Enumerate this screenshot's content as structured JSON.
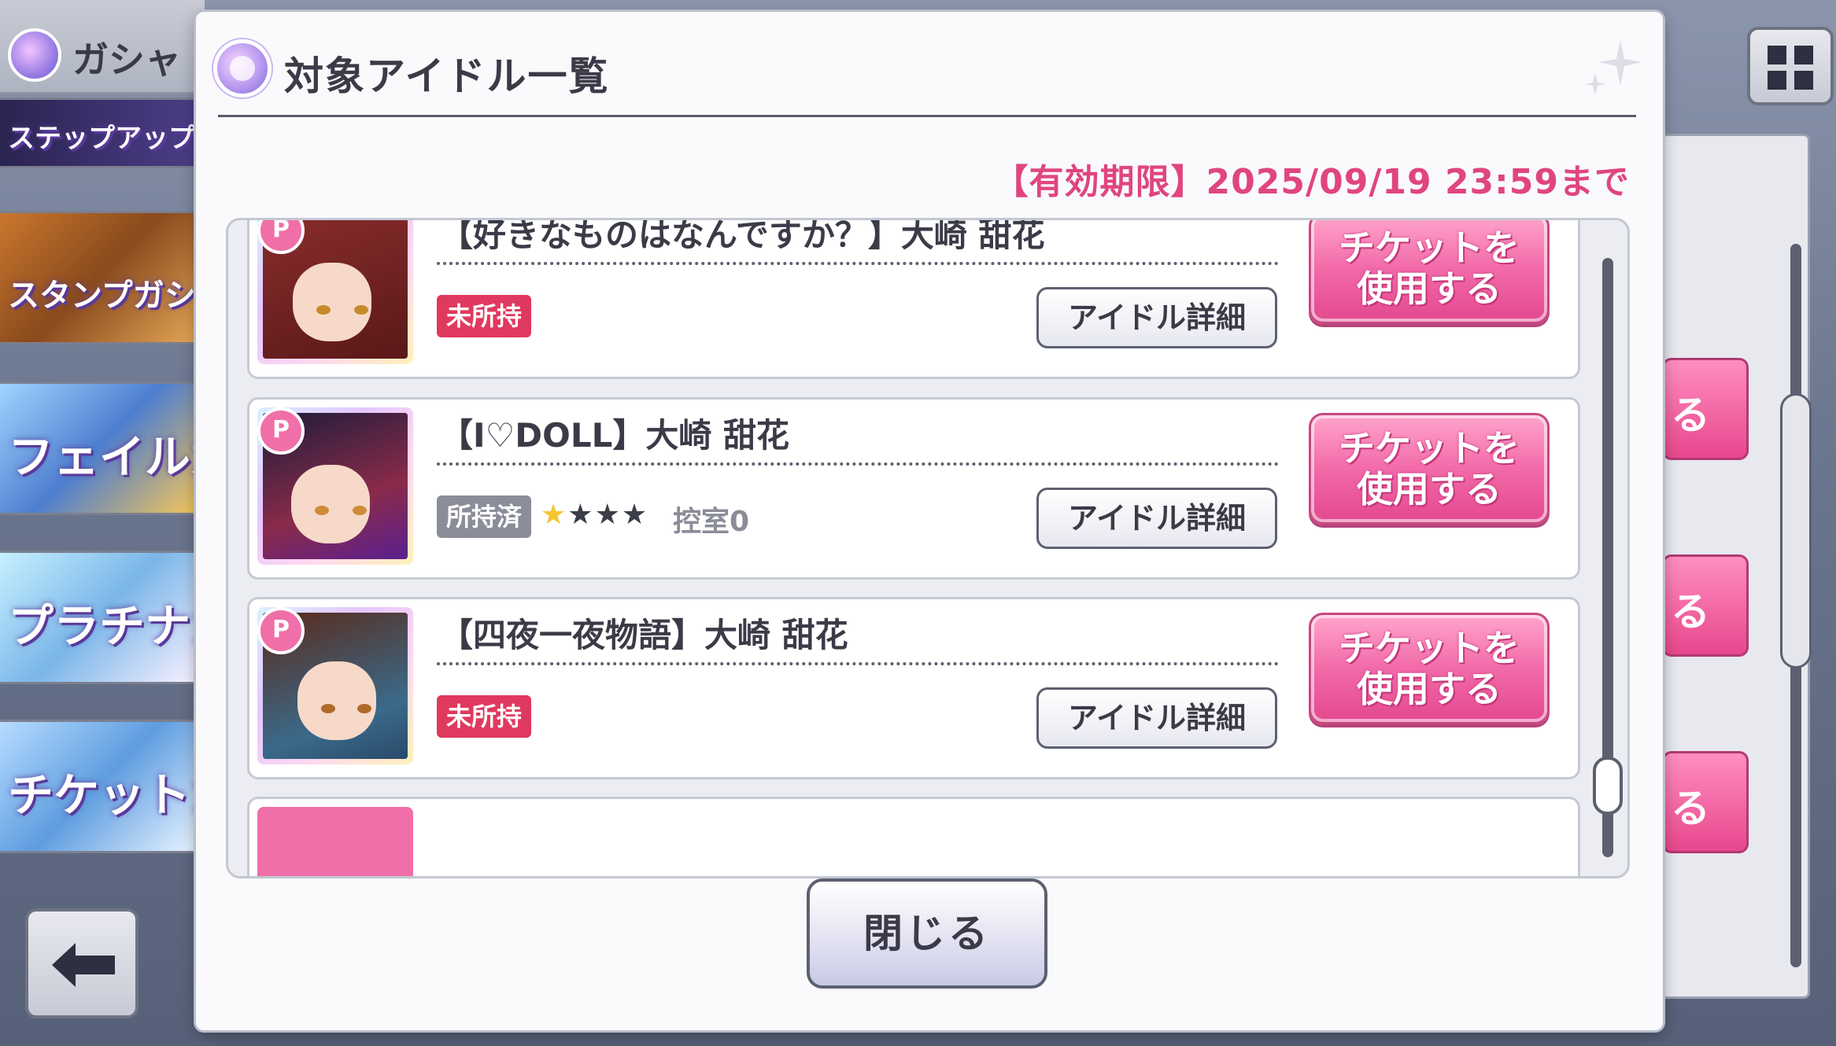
{
  "background": {
    "header_title": "ガシャ",
    "banners": [
      {
        "label": "ステップアップ"
      },
      {
        "label": "スタンプガシャ"
      },
      {
        "label": "フェイルガ"
      },
      {
        "label": "プラチナガ"
      },
      {
        "label": "チケットガ"
      }
    ],
    "side_button_label": "る"
  },
  "modal": {
    "title": "対象アイドル一覧",
    "expiry": "【有効期限】2025/09/19 23:59まで",
    "close_label": "閉じる"
  },
  "idols": [
    {
      "name": "【好きなものはなんですか？】大崎 甜花",
      "status": "未所持",
      "status_type": "unowned",
      "detail_label": "アイドル詳細",
      "use_label_line1": "チケットを",
      "use_label_line2": "使用する"
    },
    {
      "name": "【I♡DOLL】大崎 甜花",
      "status": "所持済",
      "status_type": "owned",
      "stars_filled": 1,
      "stars_total": 4,
      "waiting_room": "控室0",
      "detail_label": "アイドル詳細",
      "use_label_line1": "チケットを",
      "use_label_line2": "使用する"
    },
    {
      "name": "【四夜一夜物語】大崎 甜花",
      "status": "未所持",
      "status_type": "unowned",
      "detail_label": "アイドル詳細",
      "use_label_line1": "チケットを",
      "use_label_line2": "使用する"
    }
  ],
  "colors": {
    "accent_pink": "#e0457e",
    "badge_unowned": "#e0395f",
    "badge_owned": "#8b8d98"
  }
}
